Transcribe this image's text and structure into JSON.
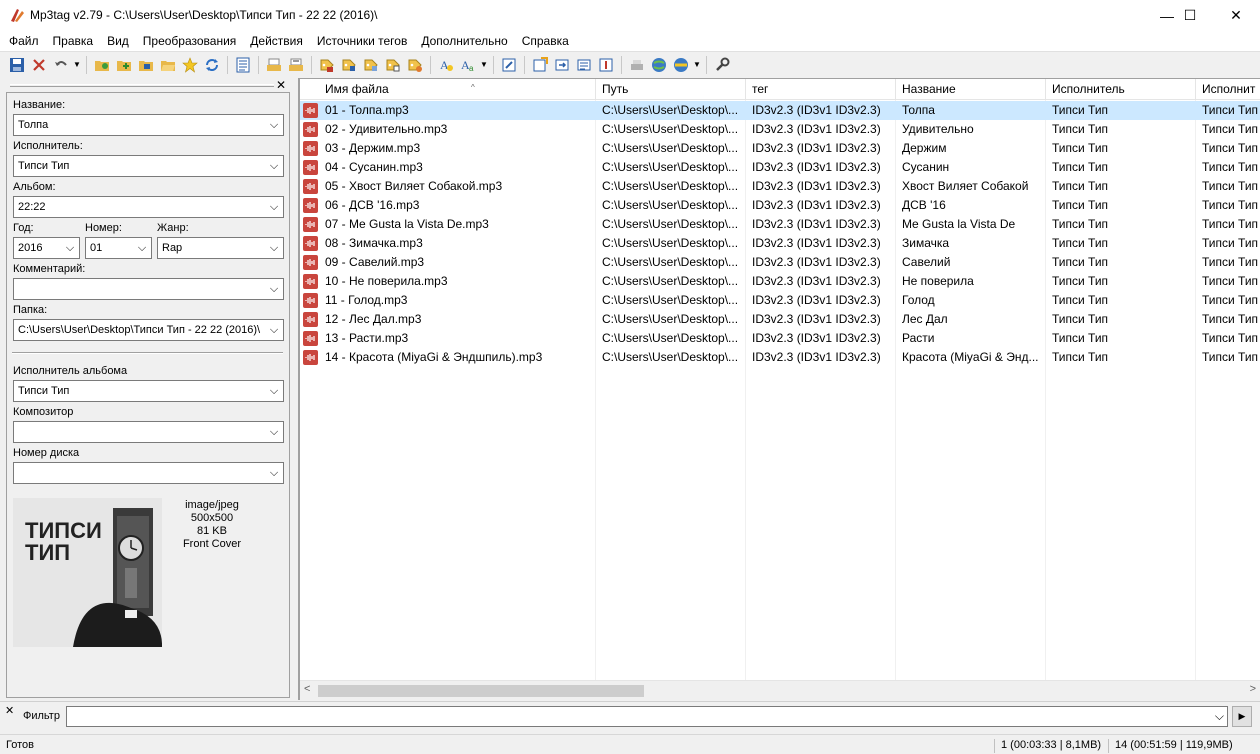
{
  "window": {
    "title": "Mp3tag v2.79  -  C:\\Users\\User\\Desktop\\Типси Тип - 22 22 (2016)\\",
    "minimize": "—",
    "maximize": "☐",
    "close": "✕"
  },
  "menu": [
    "Файл",
    "Правка",
    "Вид",
    "Преобразования",
    "Действия",
    "Источники тегов",
    "Дополнительно",
    "Справка"
  ],
  "toolbar": {
    "icons": [
      "save-icon",
      "remove-tag-icon",
      "undo-icon",
      "change-dir-icon",
      "add-dir-icon",
      "save-playlist-icon",
      "open-folder-icon",
      "favorite-icon",
      "refresh-icon",
      "list-icon",
      "cut-icon",
      "copy-icon",
      "tag-from-filename-icon",
      "filename-from-tag-icon",
      "tag-to-tag-icon",
      "text-file-icon",
      "tag-from-text-icon",
      "actions-icon",
      "autonumber-icon",
      "edit-icon",
      "export-icon",
      "import-icon",
      "quick-import-icon",
      "convert-icon",
      "freedb-icon",
      "web-source-icon",
      "web-source2-icon",
      "options-icon"
    ]
  },
  "tag_panel": {
    "close": "✕",
    "fields": [
      {
        "label": "Название:",
        "value": "Толпа"
      },
      {
        "label": "Исполнитель:",
        "value": "Типси Тип"
      },
      {
        "label": "Альбом:",
        "value": "22:22"
      }
    ],
    "year": {
      "label": "Год:",
      "value": "2016"
    },
    "track": {
      "label": "Номер:",
      "value": "01"
    },
    "genre": {
      "label": "Жанр:",
      "value": "Rap"
    },
    "comment": {
      "label": "Комментарий:",
      "value": ""
    },
    "folder": {
      "label": "Папка:",
      "value": "C:\\Users\\User\\Desktop\\Типси Тип - 22 22 (2016)\\"
    },
    "album_artist": {
      "label": "Исполнитель альбома",
      "value": "Типси Тип"
    },
    "composer": {
      "label": "Композитор",
      "value": ""
    },
    "disc": {
      "label": "Номер диска",
      "value": ""
    },
    "cover": {
      "mime": "image/jpeg",
      "dims": "500x500",
      "size": "81 KB",
      "type": "Front Cover",
      "art_text_line1": "ТИПСИ",
      "art_text_line2": "ТИП"
    }
  },
  "file_list": {
    "columns": [
      "Имя файла",
      "Путь",
      "тег",
      "Название",
      "Исполнитель",
      "Исполнит"
    ],
    "rows": [
      [
        "01 - Толпа.mp3",
        "C:\\Users\\User\\Desktop\\...",
        "ID3v2.3 (ID3v1 ID3v2.3)",
        "Толпа",
        "Типси Тип",
        "Типси Тип"
      ],
      [
        "02 - Удивительно.mp3",
        "C:\\Users\\User\\Desktop\\...",
        "ID3v2.3 (ID3v1 ID3v2.3)",
        "Удивительно",
        "Типси Тип",
        "Типси Тип"
      ],
      [
        "03 - Держим.mp3",
        "C:\\Users\\User\\Desktop\\...",
        "ID3v2.3 (ID3v1 ID3v2.3)",
        "Держим",
        "Типси Тип",
        "Типси Тип"
      ],
      [
        "04 - Сусанин.mp3",
        "C:\\Users\\User\\Desktop\\...",
        "ID3v2.3 (ID3v1 ID3v2.3)",
        "Сусанин",
        "Типси Тип",
        "Типси Тип"
      ],
      [
        "05 - Хвост Виляет Собакой.mp3",
        "C:\\Users\\User\\Desktop\\...",
        "ID3v2.3 (ID3v1 ID3v2.3)",
        "Хвост Виляет Собакой",
        "Типси Тип",
        "Типси Тип"
      ],
      [
        "06 - ДСВ '16.mp3",
        "C:\\Users\\User\\Desktop\\...",
        "ID3v2.3 (ID3v1 ID3v2.3)",
        "ДСВ '16",
        "Типси Тип",
        "Типси Тип"
      ],
      [
        "07 - Me Gusta la Vista De.mp3",
        "C:\\Users\\User\\Desktop\\...",
        "ID3v2.3 (ID3v1 ID3v2.3)",
        "Me Gusta la Vista De",
        "Типси Тип",
        "Типси Тип"
      ],
      [
        "08 - Зимачка.mp3",
        "C:\\Users\\User\\Desktop\\...",
        "ID3v2.3 (ID3v1 ID3v2.3)",
        "Зимачка",
        "Типси Тип",
        "Типси Тип"
      ],
      [
        "09 - Савелий.mp3",
        "C:\\Users\\User\\Desktop\\...",
        "ID3v2.3 (ID3v1 ID3v2.3)",
        "Савелий",
        "Типси Тип",
        "Типси Тип"
      ],
      [
        "10 - Не поверила.mp3",
        "C:\\Users\\User\\Desktop\\...",
        "ID3v2.3 (ID3v1 ID3v2.3)",
        "Не поверила",
        "Типси Тип",
        "Типси Тип"
      ],
      [
        "11 - Голод.mp3",
        "C:\\Users\\User\\Desktop\\...",
        "ID3v2.3 (ID3v1 ID3v2.3)",
        "Голод",
        "Типси Тип",
        "Типси Тип"
      ],
      [
        "12 - Лес Дал.mp3",
        "C:\\Users\\User\\Desktop\\...",
        "ID3v2.3 (ID3v1 ID3v2.3)",
        "Лес Дал",
        "Типси Тип",
        "Типси Тип"
      ],
      [
        "13 - Расти.mp3",
        "C:\\Users\\User\\Desktop\\...",
        "ID3v2.3 (ID3v1 ID3v2.3)",
        "Расти",
        "Типси Тип",
        "Типси Тип"
      ],
      [
        "14 - Красота (MiyaGi & Эндшпиль).mp3",
        "C:\\Users\\User\\Desktop\\...",
        "ID3v2.3 (ID3v1 ID3v2.3)",
        "Красота (MiyaGi & Энд...",
        "Типси Тип",
        "Типси Тип"
      ]
    ],
    "selected_row": 0
  },
  "filter": {
    "close": "✕",
    "label": "Фильтр",
    "value": ""
  },
  "status": {
    "text": "Готов",
    "selected": "1 (00:03:33 | 8,1MB)",
    "total": "14 (00:51:59 | 119,9MB)"
  },
  "colors": {
    "selection": "#cce8ff",
    "file_icon": "#c9453d"
  }
}
